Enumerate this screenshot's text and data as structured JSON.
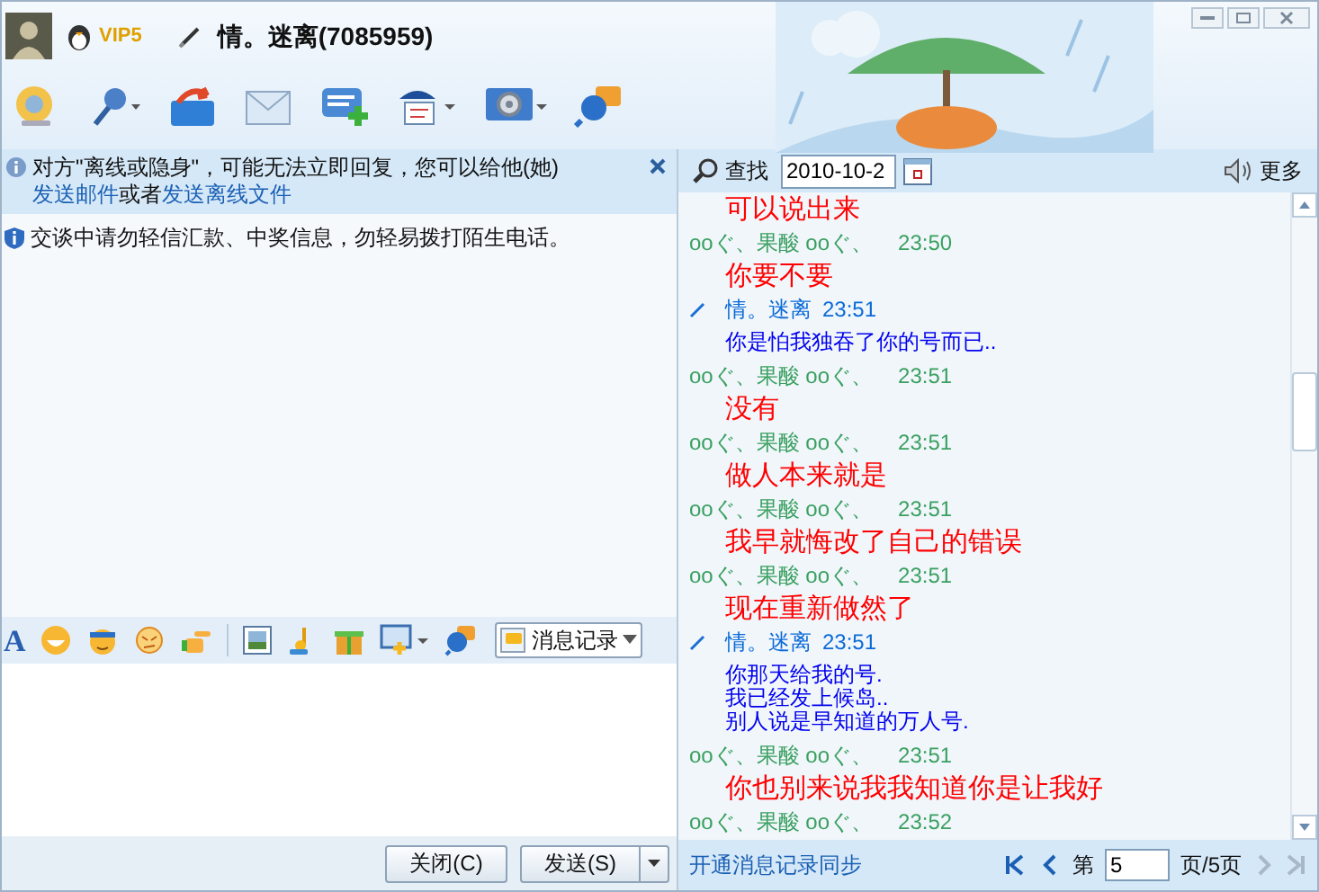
{
  "title_bar": {
    "vip_badge": "VIP5",
    "contact_name": "情。迷离(7085959)"
  },
  "notice": {
    "segments": [
      {
        "kind": "text",
        "text": "对方\"离线或隐身\"，可能无法立即回复，您可以给他(她)"
      },
      {
        "kind": "link",
        "text": "发送邮件"
      },
      {
        "kind": "text",
        "text": "或者"
      },
      {
        "kind": "link",
        "text": "发送离线文件"
      }
    ]
  },
  "warning": "交谈中请勿轻信汇款、中奖信息，勿轻易拨打陌生电话。",
  "format_toolbar": {
    "font_button": "A",
    "history_button": "消息记录"
  },
  "buttons": {
    "close": "关闭(C)",
    "send": "发送(S)"
  },
  "history": {
    "search_label": "查找",
    "date": "2010-10-2",
    "more": "更多",
    "messages": [
      {
        "kind": "peer",
        "lines": [
          "可以说出来"
        ]
      },
      {
        "kind": "peer",
        "sender": "ooぐ、果酸 ooぐ、",
        "time": "23:50",
        "lines": [
          "你要不要"
        ]
      },
      {
        "kind": "self",
        "sender": "情。迷离",
        "time": "23:51",
        "lines": [
          "你是怕我独吞了你的号而已.."
        ]
      },
      {
        "kind": "peer",
        "sender": "ooぐ、果酸 ooぐ、",
        "time": "23:51",
        "lines": [
          "没有"
        ]
      },
      {
        "kind": "peer",
        "sender": "ooぐ、果酸 ooぐ、",
        "time": "23:51",
        "lines": [
          "做人本来就是"
        ]
      },
      {
        "kind": "peer",
        "sender": "ooぐ、果酸 ooぐ、",
        "time": "23:51",
        "lines": [
          "我早就悔改了自己的错误"
        ]
      },
      {
        "kind": "peer",
        "sender": "ooぐ、果酸 ooぐ、",
        "time": "23:51",
        "lines": [
          "现在重新做然了"
        ]
      },
      {
        "kind": "self",
        "sender": "情。迷离",
        "time": "23:51",
        "lines": [
          "你那天给我的号.",
          "我已经发上候岛..",
          "别人说是早知道的万人号."
        ]
      },
      {
        "kind": "peer",
        "sender": "ooぐ、果酸 ooぐ、",
        "time": "23:51",
        "lines": [
          "你也别来说我我知道你是让我好"
        ]
      },
      {
        "kind": "peer",
        "sender": "ooぐ、果酸 ooぐ、",
        "time": "23:52"
      }
    ],
    "sync_link": "开通消息记录同步",
    "nav": [
      {
        "kind": "first",
        "disabled": false
      },
      {
        "kind": "prev",
        "disabled": false
      },
      {
        "kind": "next",
        "disabled": true
      },
      {
        "kind": "last",
        "disabled": true
      }
    ],
    "page_prefix": "第",
    "page": "5",
    "page_suffix": "页/5页"
  }
}
